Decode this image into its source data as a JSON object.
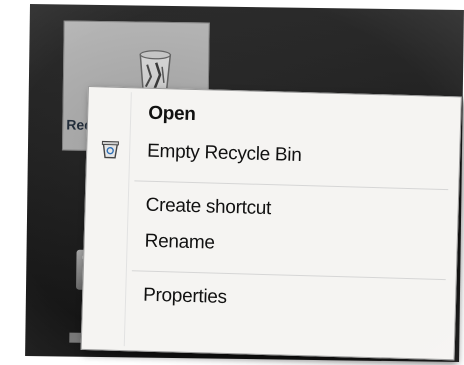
{
  "desktop": {
    "recycle_bin_label": "Recyc",
    "icons": {
      "recycle_bin": "recycle-bin-icon",
      "second": "desktop-shortcut-icon"
    }
  },
  "context_menu": {
    "items": [
      {
        "label": "Open",
        "bold": true,
        "icon": null
      },
      {
        "label": "Empty Recycle Bin",
        "bold": false,
        "icon": "empty-recycle-bin-icon"
      },
      {
        "label": "Create shortcut",
        "bold": false,
        "icon": null
      },
      {
        "label": "Rename",
        "bold": false,
        "icon": null
      },
      {
        "label": "Properties",
        "bold": false,
        "icon": null
      }
    ]
  },
  "colors": {
    "menu_background": "#f5f4f2",
    "desktop_background": "#1c1c1c",
    "selection": "#bdbdbd",
    "text": "#111111"
  }
}
